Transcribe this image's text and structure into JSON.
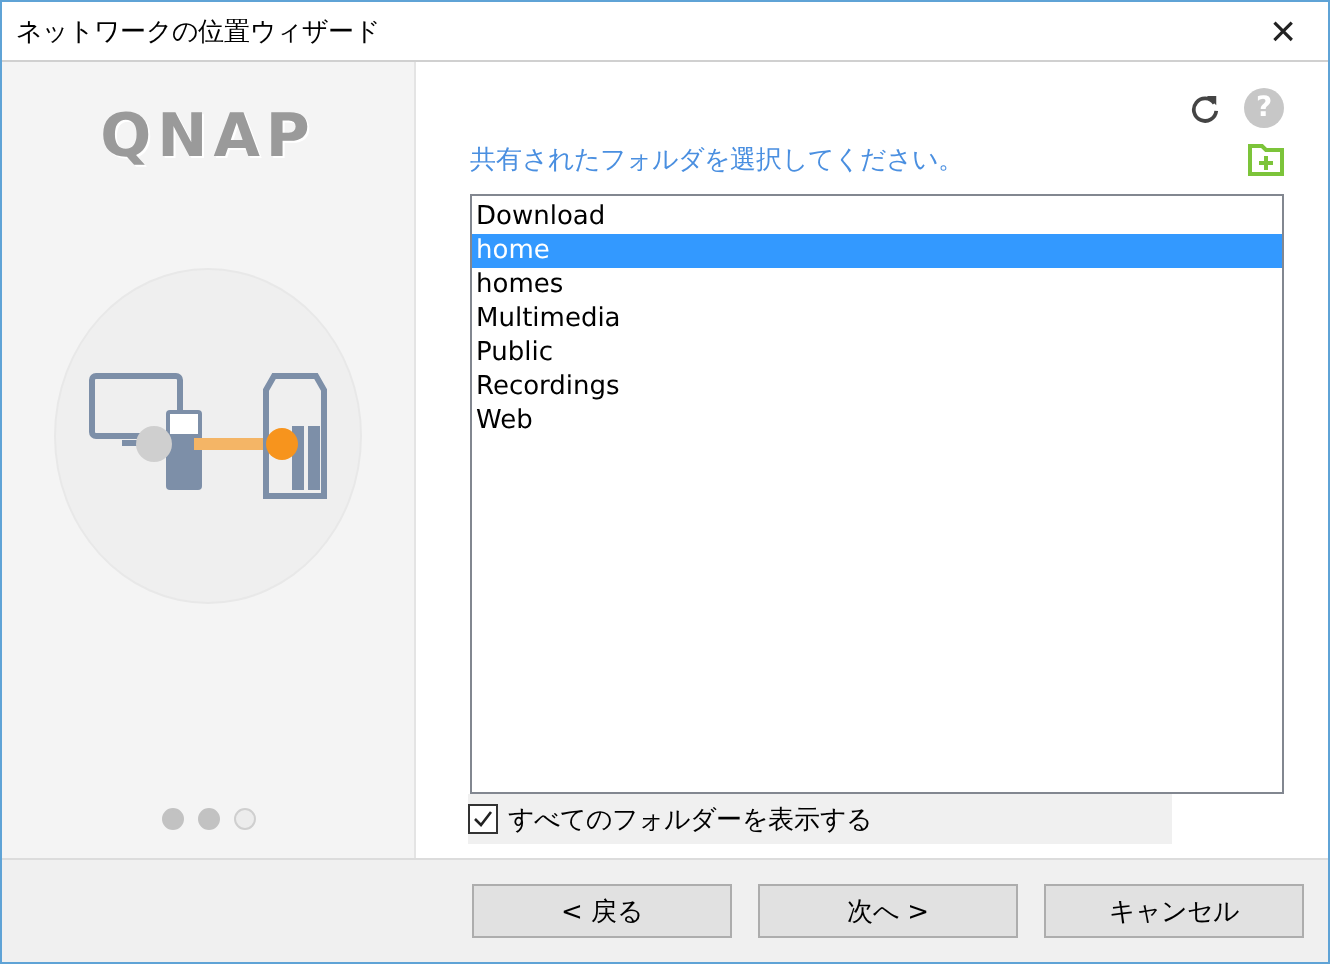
{
  "window": {
    "title": "ネットワークの位置ウィザード",
    "close": "×"
  },
  "sidebar": {
    "logo": "QNAP",
    "dots": [
      {
        "filled": true
      },
      {
        "filled": true
      },
      {
        "filled": false
      }
    ]
  },
  "prompt": "共有されたフォルダを選択してください。",
  "help": "?",
  "folders": [
    {
      "name": "Download",
      "selected": false
    },
    {
      "name": "home",
      "selected": true
    },
    {
      "name": "homes",
      "selected": false
    },
    {
      "name": "Multimedia",
      "selected": false
    },
    {
      "name": "Public",
      "selected": false
    },
    {
      "name": "Recordings",
      "selected": false
    },
    {
      "name": "Web",
      "selected": false
    }
  ],
  "show_all": {
    "label": "すべてのフォルダーを表示する",
    "checked": true
  },
  "buttons": [
    "< 戻る",
    "次へ >",
    "キャンセル"
  ]
}
